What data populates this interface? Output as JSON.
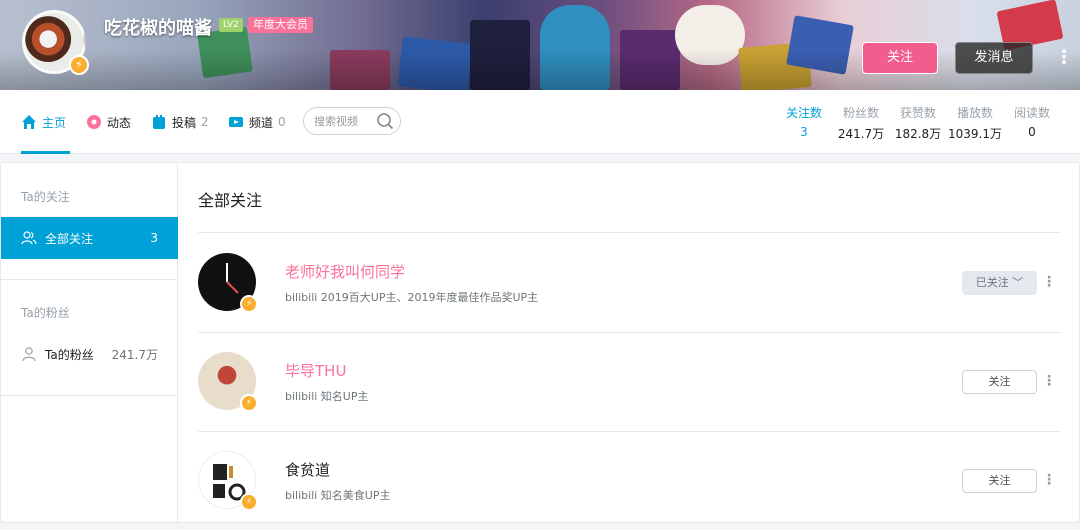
{
  "banner": {
    "username": "吃花椒的喵酱",
    "level": "LV2",
    "vip_badge": "年度大会员",
    "follow_label": "关注",
    "message_label": "发消息",
    "more_label": "⋮",
    "avatar_badge_icon": "lightning-icon"
  },
  "nav": {
    "items": [
      {
        "label": "主页",
        "count": "",
        "icon": "home-icon",
        "color": "#00a1d6"
      },
      {
        "label": "动态",
        "count": "",
        "icon": "flower-icon",
        "color": "#fb7299"
      },
      {
        "label": "投稿",
        "count": "2",
        "icon": "upload-icon",
        "color": "#00a1d6"
      },
      {
        "label": "频道",
        "count": "0",
        "icon": "channel-icon",
        "color": "#00a1d6"
      }
    ],
    "search_placeholder": "搜索视频"
  },
  "stats": [
    {
      "label": "关注数",
      "value": "3"
    },
    {
      "label": "粉丝数",
      "value": "241.7万"
    },
    {
      "label": "获赞数",
      "value": "182.8万"
    },
    {
      "label": "播放数",
      "value": "1039.1万"
    },
    {
      "label": "阅读数",
      "value": "0"
    }
  ],
  "sidebar": {
    "following_title": "Ta的关注",
    "all_following": {
      "label": "全部关注",
      "count": "3"
    },
    "fans_title": "Ta的粉丝",
    "fans": {
      "label": "Ta的粉丝",
      "count": "241.7万"
    }
  },
  "content": {
    "title": "全部关注",
    "rows": [
      {
        "name": "老师好我叫何同学",
        "desc": "bilibili 2019百大UP主、2019年度最佳作品奖UP主",
        "button": "已关注 ﹀",
        "followed": true
      },
      {
        "name": "毕导THU",
        "desc": "bilibili 知名UP主",
        "button": "关注",
        "followed": false
      },
      {
        "name": "食贫道",
        "desc": "bilibili 知名美食UP主",
        "button": "关注",
        "followed": false
      }
    ],
    "more_label": "⋮"
  },
  "colors": {
    "accent": "#00a1d6",
    "pink": "#fb7299",
    "follow_button": "#f25d8e"
  }
}
